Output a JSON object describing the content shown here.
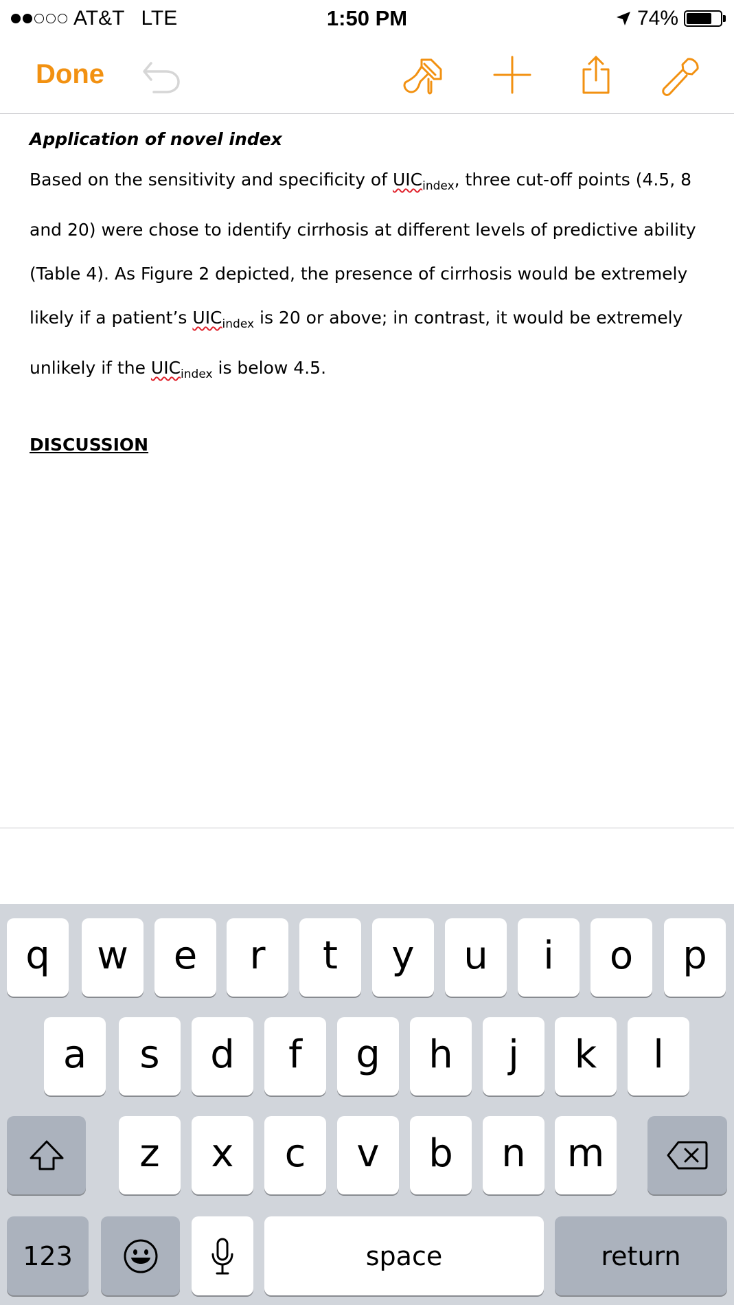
{
  "status_bar": {
    "carrier": "AT&T",
    "network": "LTE",
    "time": "1:50 PM",
    "battery_percent": "74%",
    "battery_level": 0.74,
    "signal_bars_filled": 2,
    "signal_bars_total": 5,
    "location_icon": "location-arrow-icon"
  },
  "toolbar": {
    "done_label": "Done",
    "undo_icon": "undo-icon",
    "icons": [
      "paintbrush-icon",
      "plus-icon",
      "share-icon",
      "wrench-icon"
    ]
  },
  "colors": {
    "accent": "#f29111",
    "undo_disabled": "#d6d6d6",
    "spellcheck": "#e0202a",
    "keyboard_bg": "#d1d5db",
    "key_gray": "#abb2bd"
  },
  "document": {
    "heading": "Application of novel index",
    "paragraph": {
      "p1": "Based on the sensitivity and specificity of ",
      "uic": "UIC",
      "index": "index",
      "p2": ", three cut-off points (4.5, 8 and 20) were chose to identify cirrhosis at different levels of predictive ability (Table 4).  As Figure 2 depicted, the presence of cirrhosis would be extremely likely if a patient’s ",
      "p3": " is 20 or above; in contrast, it would be extremely unlikely if the ",
      "p4": " is below 4.5."
    },
    "section_heading": "DISCUSSION"
  },
  "keyboard": {
    "row1": [
      "q",
      "w",
      "e",
      "r",
      "t",
      "y",
      "u",
      "i",
      "o",
      "p"
    ],
    "row2": [
      "a",
      "s",
      "d",
      "f",
      "g",
      "h",
      "j",
      "k",
      "l"
    ],
    "row3": [
      "z",
      "x",
      "c",
      "v",
      "b",
      "n",
      "m"
    ],
    "numbers_label": "123",
    "space_label": "space",
    "return_label": "return",
    "shift_icon": "shift-arrow-icon",
    "delete_icon": "delete-backspace-icon",
    "emoji_icon": "emoji-smiley-icon",
    "mic_icon": "microphone-icon"
  }
}
